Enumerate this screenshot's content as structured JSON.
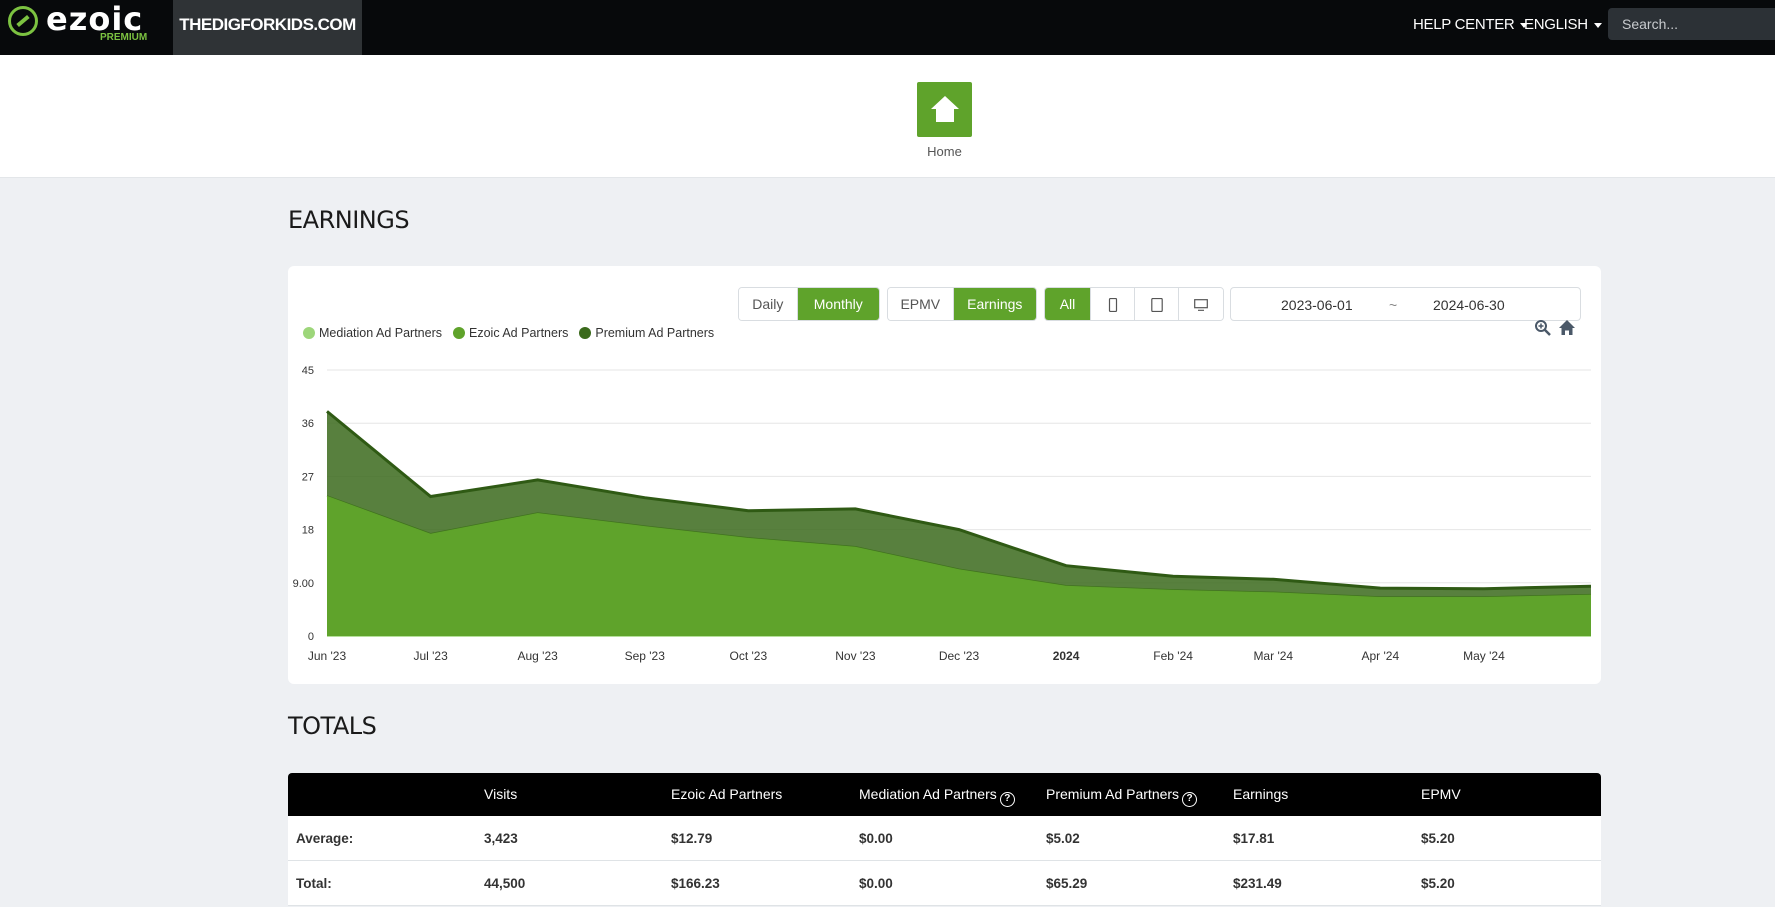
{
  "header": {
    "logo_text": "ezoic",
    "logo_sub": "PREMIUM",
    "site_name": "THEDIGFORKIDS.COM",
    "help_center": "HELP CENTER",
    "language": "ENGLISH",
    "search_placeholder": "Search..."
  },
  "home": {
    "label": "Home"
  },
  "earnings": {
    "title": "EARNINGS",
    "period_buttons": [
      "Daily",
      "Monthly"
    ],
    "period_selected": "Monthly",
    "metric_buttons": [
      "EPMV",
      "Earnings"
    ],
    "metric_selected": "Earnings",
    "device_buttons": {
      "all": "All",
      "icons": [
        "mobile-icon",
        "tablet-icon",
        "desktop-icon"
      ]
    },
    "device_selected": "All",
    "date_start": "2023-06-01",
    "date_separator": "~",
    "date_end": "2024-06-30"
  },
  "chart_data": {
    "type": "area",
    "stacked": true,
    "legend": [
      "Mediation Ad Partners",
      "Ezoic Ad Partners",
      "Premium Ad Partners"
    ],
    "legend_colors": [
      "#9dd67a",
      "#5fa32b",
      "#3b6a1c"
    ],
    "legend_placement": "top-left",
    "x_tick_labels": [
      "Jun '23",
      "Jul '23",
      "Aug '23",
      "Sep '23",
      "Oct '23",
      "Nov '23",
      "Dec '23",
      "2024",
      "Feb '24",
      "Mar '24",
      "Apr '24",
      "May '24"
    ],
    "x": [
      "2023-06-01",
      "2023-07-01",
      "2023-08-01",
      "2023-09-01",
      "2023-10-01",
      "2023-11-01",
      "2023-12-01",
      "2024-01-01",
      "2024-02-01",
      "2024-03-01",
      "2024-04-01",
      "2024-05-01",
      "2024-06-01"
    ],
    "y_ticks": [
      "0",
      "9.00",
      "18",
      "27",
      "36",
      "45"
    ],
    "ylim": [
      0,
      45
    ],
    "grid": true,
    "series": [
      {
        "name": "Mediation Ad Partners",
        "color": "#9dd67a",
        "values": [
          0,
          0,
          0,
          0,
          0,
          0,
          0,
          0,
          0,
          0,
          0,
          0,
          0
        ]
      },
      {
        "name": "Ezoic Ad Partners",
        "color": "#5fa32b",
        "values": [
          23.7,
          17.3,
          20.8,
          18.6,
          16.6,
          15.1,
          11.3,
          8.5,
          7.8,
          7.4,
          6.6,
          6.6,
          7.0
        ]
      },
      {
        "name": "Premium Ad Partners",
        "color": "#3b6a1c",
        "values": [
          14.3,
          6.3,
          5.6,
          4.8,
          4.6,
          6.4,
          6.7,
          3.4,
          2.3,
          2.2,
          1.5,
          1.4,
          1.4
        ]
      }
    ]
  },
  "totals": {
    "title": "TOTALS",
    "headers": [
      "Visits",
      "Ezoic Ad Partners",
      "Mediation Ad Partners",
      "Premium Ad Partners",
      "Earnings",
      "EPMV"
    ],
    "rows": [
      {
        "label": "Average:",
        "values": [
          "3,423",
          "$12.79",
          "$0.00",
          "$5.02",
          "$17.81",
          "$5.20"
        ]
      },
      {
        "label": "Total:",
        "values": [
          "44,500",
          "$166.23",
          "$0.00",
          "$65.29",
          "$231.49",
          "$5.20"
        ]
      }
    ]
  }
}
